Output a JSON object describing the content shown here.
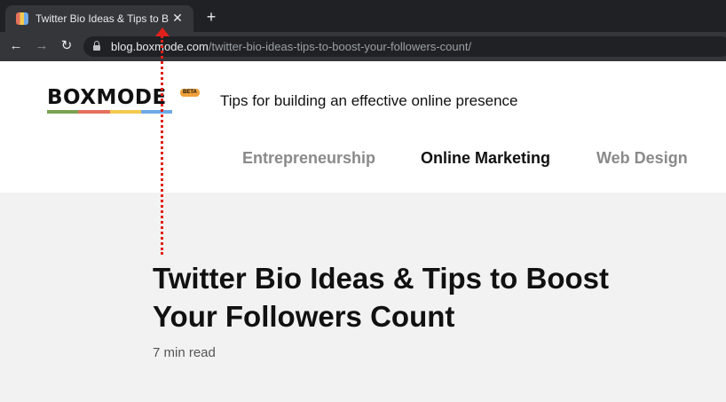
{
  "browser": {
    "tab": {
      "title": "Twitter Bio Ideas & Tips to Boo",
      "close_icon": "close-icon",
      "favicon_icon": "boxmode-favicon"
    },
    "new_tab_icon": "plus-icon",
    "nav": {
      "back_icon": "arrow-left-icon",
      "forward_icon": "arrow-right-icon",
      "reload_icon": "reload-icon"
    },
    "url": {
      "host": "blog.boxmode.com",
      "path": "/twitter-bio-ideas-tips-to-boost-your-followers-count/",
      "lock_icon": "lock-icon"
    }
  },
  "site": {
    "logo_text": "BOXMODE",
    "beta_label": "BETA",
    "tagline": "Tips for building an effective online presence",
    "nav": [
      {
        "label": "Entrepreneurship",
        "active": false
      },
      {
        "label": "Online Marketing",
        "active": true
      },
      {
        "label": "Web Design",
        "active": false
      }
    ],
    "logo_colors": [
      "#7aa14f",
      "#e5705c",
      "#f3c94f",
      "#6ea9e6"
    ]
  },
  "article": {
    "title": "Twitter Bio Ideas & Tips to Boost Your Followers Count",
    "read_time": "7 min read"
  },
  "annotation": {
    "color": "#e0211b",
    "icon": "dotted-arrow-up-icon"
  }
}
